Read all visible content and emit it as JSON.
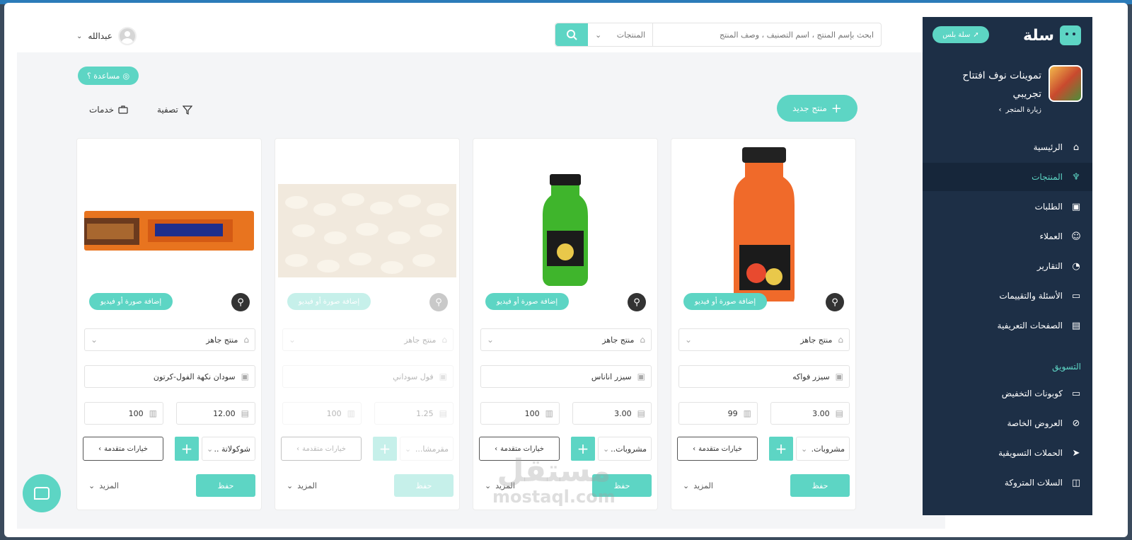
{
  "topbar": {
    "search_placeholder": "ابحث بإسم المنتج ، اسم التصنيف ، وصف المنتج",
    "search_scope": "المنتجات",
    "user_name": "عبدالله"
  },
  "toolbar": {
    "help_label": "مساعدة ؟",
    "new_product_label": "منتج جديد",
    "filter_label": "تصفية",
    "services_label": "خدمات"
  },
  "card_labels": {
    "add_media": "إضافة صورة أو فيديو",
    "advanced_options": "خيارات متقدمة",
    "save": "حفظ",
    "more": "المزيد"
  },
  "products": [
    {
      "type": "منتج جاهز",
      "name": "سيزر فواكه",
      "price": "3.00",
      "qty": "99",
      "category": "مشروبات."
    },
    {
      "type": "منتج جاهز",
      "name": "سيزر اناناس",
      "price": "3.00",
      "qty": "100",
      "category": "مشروبات.."
    },
    {
      "type": "منتج جاهز",
      "name": "فول سوداني",
      "price": "1.25",
      "qty": "100",
      "category": "مقرمشا..."
    },
    {
      "type": "منتج جاهز",
      "name": "سودان نكهة الفول-كرتون",
      "price": "12.00",
      "qty": "100",
      "category": "شوكولاتة .."
    }
  ],
  "sidebar": {
    "brand": "سلة",
    "plus_badge": "سلة بلس",
    "store_name": "تموينات نوف افتتاح تجريبي",
    "visit_store": "زيارة المتجر",
    "items": [
      {
        "label": "الرئيسية",
        "icon": "home-icon"
      },
      {
        "label": "المنتجات",
        "icon": "shirt-icon"
      },
      {
        "label": "الطلبات",
        "icon": "box-icon"
      },
      {
        "label": "العملاء",
        "icon": "users-icon"
      },
      {
        "label": "التقارير",
        "icon": "pie-chart-icon"
      },
      {
        "label": "الأسئلة والتقييمات",
        "icon": "chat-icon"
      },
      {
        "label": "الصفحات التعريفية",
        "icon": "document-icon"
      }
    ],
    "marketing_title": "التسويق",
    "marketing_items": [
      {
        "label": "كوبونات التخفيض",
        "icon": "ticket-icon"
      },
      {
        "label": "العروض الخاصة",
        "icon": "percent-icon"
      },
      {
        "label": "الحملات التسويقية",
        "icon": "send-icon"
      },
      {
        "label": "السلات المتروكة",
        "icon": "cart-icon"
      }
    ]
  },
  "watermark": {
    "ar": "مستقل",
    "en": "mostaql.com"
  },
  "colors": {
    "accent": "#5dd5c4",
    "sidebar": "#1d2f46",
    "active_bg": "#16263a"
  }
}
